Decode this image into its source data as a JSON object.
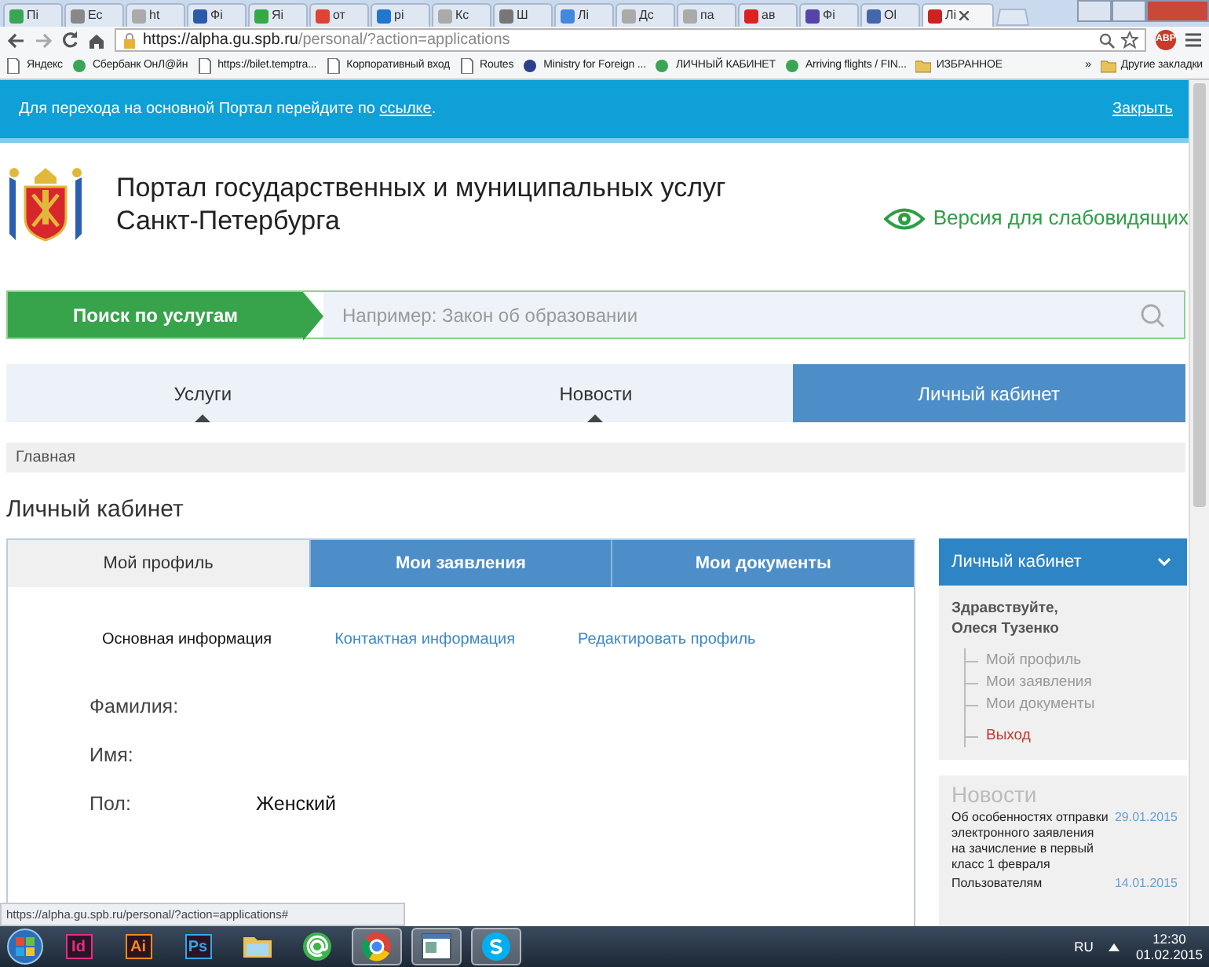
{
  "browser": {
    "tabs": [
      {
        "title": "Пі",
        "color": "#3aa655",
        "selected": false
      },
      {
        "title": "Ес",
        "color": "#888888",
        "selected": false
      },
      {
        "title": "ht",
        "color": "#aaaaaa",
        "selected": false
      },
      {
        "title": "Фі",
        "color": "#2b5aa8",
        "selected": false
      },
      {
        "title": "Яі",
        "color": "#33aa44",
        "selected": false
      },
      {
        "title": "от",
        "color": "#dd4433",
        "selected": false
      },
      {
        "title": "pi",
        "color": "#2277cc",
        "selected": false
      },
      {
        "title": "Кс",
        "color": "#aaaaaa",
        "selected": false
      },
      {
        "title": "Ш",
        "color": "#777777",
        "selected": false
      },
      {
        "title": "Лі",
        "color": "#4488dd",
        "selected": false
      },
      {
        "title": "Дс",
        "color": "#aaaaaa",
        "selected": false
      },
      {
        "title": "па",
        "color": "#aaaaaa",
        "selected": false
      },
      {
        "title": "ав",
        "color": "#dd2222",
        "selected": false
      },
      {
        "title": "Фі",
        "color": "#5544aa",
        "selected": false
      },
      {
        "title": "Ol",
        "color": "#4466aa",
        "selected": false
      },
      {
        "title": "Лі",
        "color": "#cc2222",
        "selected": true
      }
    ],
    "url_host": "https://alpha.gu.spb.ru",
    "url_path": "/personal/?action=applications",
    "adblock": "ABP",
    "bookmarks": [
      {
        "label": "Яндекс",
        "kind": "page"
      },
      {
        "label": "Сбербанк ОнЛ@йн",
        "kind": "site"
      },
      {
        "label": "https://bilet.temptra...",
        "kind": "page"
      },
      {
        "label": "Корпоративный вход",
        "kind": "page"
      },
      {
        "label": "Routes",
        "kind": "page"
      },
      {
        "label": "Ministry for Foreign ...",
        "kind": "emblem"
      },
      {
        "label": "ЛИЧНЫЙ КАБИНЕТ",
        "kind": "site"
      },
      {
        "label": "Arriving flights / FIN...",
        "kind": "site"
      },
      {
        "label": "ИЗБРАННОЕ",
        "kind": "folder"
      }
    ],
    "bookmarks_more": "»",
    "other_bookmarks": "Другие закладки"
  },
  "banner": {
    "text": "Для перехода на основной Портал перейдите по",
    "link": "ссылке",
    "end": ".",
    "close": "Закрыть"
  },
  "header": {
    "title_lines": [
      "Портал государственных и муниципальных услуг",
      "Санкт-Петербурга"
    ],
    "accessibility_link": "Версия для слабовидящих"
  },
  "search": {
    "label": "Поиск по услугам",
    "placeholder": "Например: Закон об образовании"
  },
  "nav": [
    {
      "label": "Услуги",
      "selected": false
    },
    {
      "label": "Новости",
      "selected": false
    },
    {
      "label": "Личный кабинет",
      "selected": true
    }
  ],
  "breadcrumb": [
    "Главная"
  ],
  "page_title": "Личный кабинет",
  "profile": {
    "tabs": [
      {
        "label": "Мой профиль",
        "selected": true
      },
      {
        "label": "Мои заявления",
        "selected": false
      },
      {
        "label": "Мои документы",
        "selected": false
      }
    ],
    "subtabs": [
      {
        "label": "Основная информация",
        "selected": true
      },
      {
        "label": "Контактная информация",
        "selected": false
      },
      {
        "label": "Редактировать профиль",
        "selected": false
      }
    ],
    "fields": [
      {
        "label": "Фамилия:"
      },
      {
        "label": "Имя:"
      },
      {
        "label": "Пол:",
        "value": "Женский"
      }
    ]
  },
  "sidebar": {
    "header": "Личный кабинет",
    "greeting": [
      "Здравствуйте,",
      "Олеся Тузенко"
    ],
    "links": [
      {
        "label": "Мой профиль",
        "kind": "link"
      },
      {
        "label": "Мои заявления",
        "kind": "link"
      },
      {
        "label": "Мои документы",
        "kind": "link"
      },
      {
        "label": "Выход",
        "kind": "exit"
      }
    ]
  },
  "news": {
    "title": "Новости",
    "items": [
      {
        "title": "Об особенностях отправки электронного заявления на зачисление в первый класс 1 февраля",
        "date": "29.01.2015"
      },
      {
        "title": "Пользователям",
        "date": "14.01.2015"
      }
    ]
  },
  "status_url": "https://alpha.gu.spb.ru/personal/?action=applications#",
  "taskbar": {
    "apps": [
      {
        "kind": "tile",
        "label": "Id",
        "color": "#e0308a",
        "active": false
      },
      {
        "kind": "tile",
        "label": "Ai",
        "color": "#f08a1c",
        "active": false
      },
      {
        "kind": "tile",
        "label": "Ps",
        "color": "#31a8e8",
        "active": false
      },
      {
        "kind": "folder",
        "active": false
      },
      {
        "kind": "mail",
        "active": false
      },
      {
        "kind": "browser",
        "active": true
      },
      {
        "kind": "window",
        "active": true
      },
      {
        "kind": "skype",
        "active": true
      }
    ],
    "language": "RU",
    "time": "12:30",
    "date": "01.02.2015"
  }
}
